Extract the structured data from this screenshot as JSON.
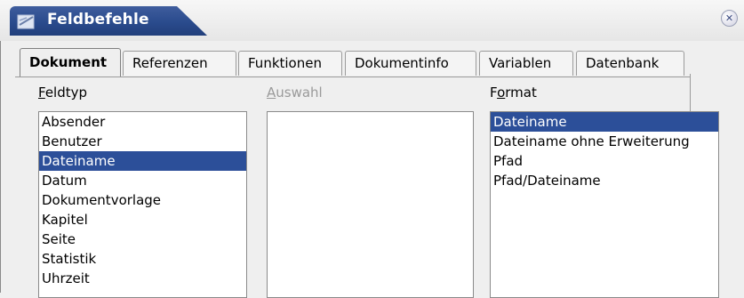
{
  "window": {
    "title": "Feldbefehle",
    "close_icon": "close-icon"
  },
  "tabs": [
    {
      "label": "Dokument",
      "active": true
    },
    {
      "label": "Referenzen",
      "active": false
    },
    {
      "label": "Funktionen",
      "active": false
    },
    {
      "label": "Dokumentinfo",
      "active": false
    },
    {
      "label": "Variablen",
      "active": false
    },
    {
      "label": "Datenbank",
      "active": false
    }
  ],
  "feldtyp": {
    "label_first": "F",
    "label_rest": "eldtyp",
    "items": [
      "Absender",
      "Benutzer",
      "Dateiname",
      "Datum",
      "Dokumentvorlage",
      "Kapitel",
      "Seite",
      "Statistik",
      "Uhrzeit"
    ],
    "selected": "Dateiname"
  },
  "auswahl": {
    "label_first": "A",
    "label_rest": "uswahl",
    "items": []
  },
  "format": {
    "label_first": "F",
    "label_u": "o",
    "label_rest": "rmat",
    "items": [
      "Dateiname",
      "Dateiname ohne Erweiterung",
      "Pfad",
      "Pfad/Dateiname"
    ],
    "selected": "Dateiname"
  },
  "colors": {
    "selection": "#2c4f99",
    "title_bar": "#2a4b8d"
  }
}
